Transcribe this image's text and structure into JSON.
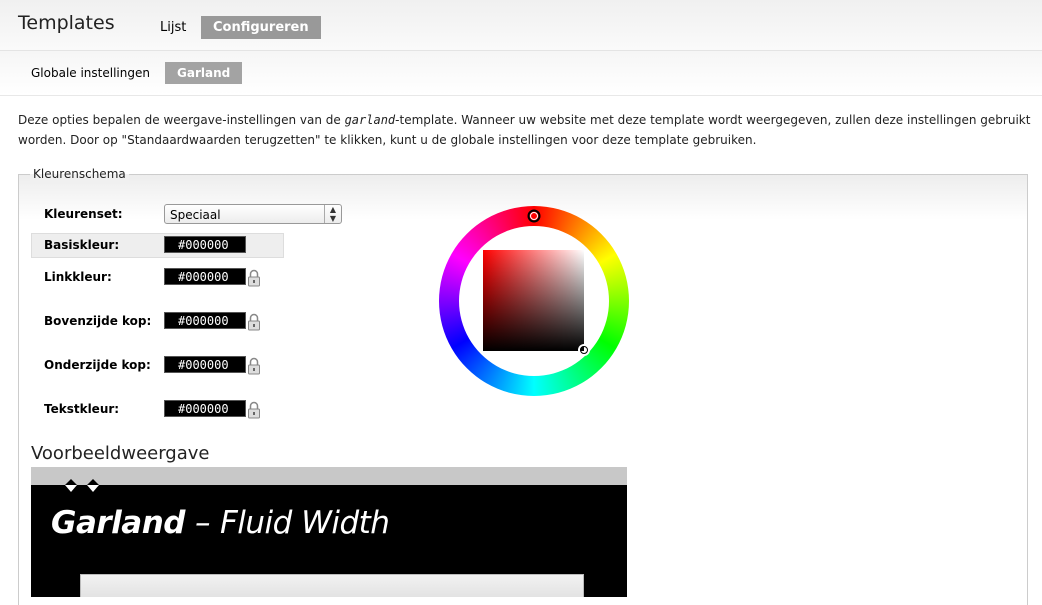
{
  "header": {
    "title": "Templates",
    "tabs": [
      {
        "label": "Lijst",
        "active": false
      },
      {
        "label": "Configureren",
        "active": true
      }
    ]
  },
  "subtabs": [
    {
      "label": "Globale instellingen",
      "active": false
    },
    {
      "label": "Garland",
      "active": true
    }
  ],
  "intro": {
    "part1": "Deze opties bepalen de weergave-instellingen van de ",
    "template_name": "garland",
    "part2": "-template. Wanneer uw website met deze template wordt weergegeven, zullen deze instellingen gebruikt worden. Door op \"Standaardwaarden terugzetten\" te klikken, kunt u de globale instellingen voor deze template gebruiken."
  },
  "color_scheme": {
    "legend": "Kleurenschema",
    "set_label": "Kleurenset:",
    "set_value": "Speciaal",
    "fields": [
      {
        "label": "Basiskleur:",
        "value": "#000000",
        "locked": false
      },
      {
        "label": "Linkkleur:",
        "value": "#000000",
        "locked": true
      },
      {
        "label": "Bovenzijde kop:",
        "value": "#000000",
        "locked": true
      },
      {
        "label": "Onderzijde kop:",
        "value": "#000000",
        "locked": true
      },
      {
        "label": "Tekstkleur:",
        "value": "#000000",
        "locked": true
      }
    ],
    "selected_color": "#000000",
    "hue_color": "#ff0000"
  },
  "preview": {
    "title": "Voorbeeldweergave",
    "site_name": "Garland",
    "separator": "–",
    "slogan": "Fluid Width"
  }
}
